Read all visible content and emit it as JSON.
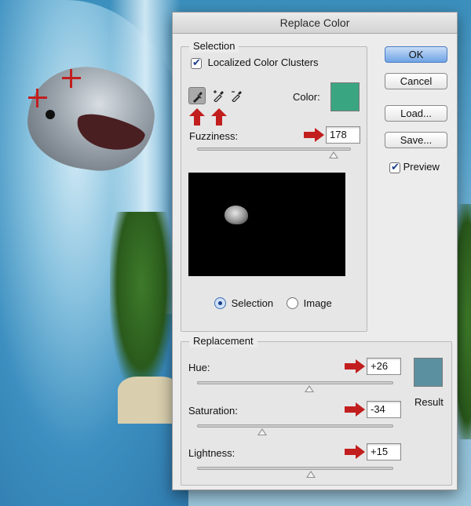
{
  "dialog": {
    "title": "Replace Color",
    "selection": {
      "legend": "Selection",
      "localized_clusters": {
        "label": "Localized Color Clusters",
        "checked": true
      },
      "tools": [
        {
          "name": "eyedropper-icon",
          "active": true
        },
        {
          "name": "eyedropper-plus-icon",
          "active": false
        },
        {
          "name": "eyedropper-minus-icon",
          "active": false
        }
      ],
      "color_label": "Color:",
      "color_value": "#3aa681",
      "fuzziness": {
        "label": "Fuzziness:",
        "value": "178",
        "fraction": 0.89
      },
      "view_options": [
        {
          "label": "Selection",
          "selected": true
        },
        {
          "label": "Image",
          "selected": false
        }
      ]
    },
    "buttons": {
      "ok": "OK",
      "cancel": "Cancel",
      "load": "Load...",
      "save": "Save..."
    },
    "preview": {
      "label": "Preview",
      "checked": true
    },
    "replacement": {
      "legend": "Replacement",
      "hue": {
        "label": "Hue:",
        "value": "+26",
        "fraction": 0.57
      },
      "saturation": {
        "label": "Saturation:",
        "value": "-34",
        "fraction": 0.33
      },
      "lightness": {
        "label": "Lightness:",
        "value": "+15",
        "fraction": 0.58
      },
      "result_label": "Result",
      "result_color": "#5a909f"
    }
  },
  "annotations": {
    "arrow_color": "#c21e1e"
  }
}
